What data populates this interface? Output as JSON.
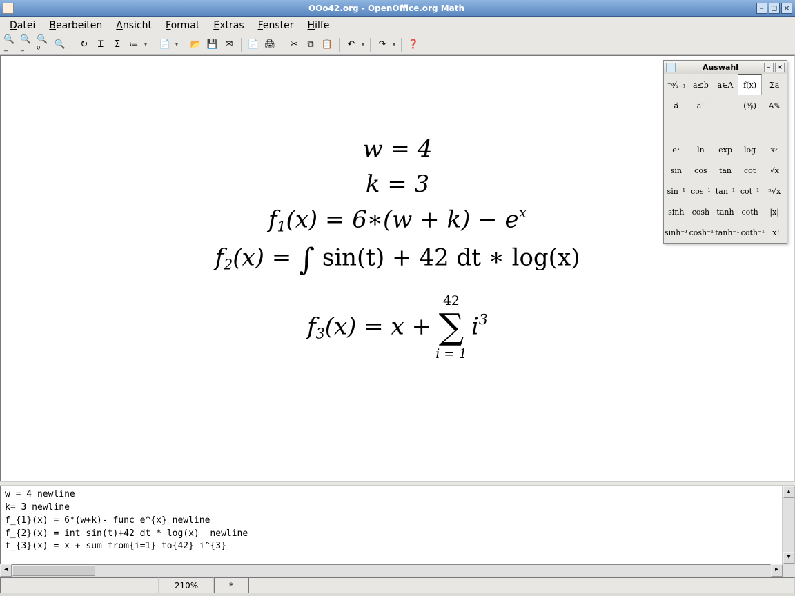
{
  "window": {
    "title": "OOo42.org - OpenOffice.org Math"
  },
  "menubar": {
    "items": [
      {
        "hot": "D",
        "rest": "atei"
      },
      {
        "hot": "B",
        "rest": "earbeiten"
      },
      {
        "hot": "A",
        "rest": "nsicht"
      },
      {
        "hot": "F",
        "rest": "ormat"
      },
      {
        "hot": "E",
        "rest": "xtras"
      },
      {
        "hot": "F",
        "rest": "enster"
      },
      {
        "hot": "H",
        "rest": "ilfe"
      }
    ]
  },
  "toolbar": {
    "groups": [
      [
        "zoom-in-icon",
        "zoom-out-icon",
        "zoom-100-icon",
        "zoom-page-icon"
      ],
      [
        "refresh-icon",
        "cursor-icon",
        "sigma-icon",
        "catalog-icon"
      ],
      [
        "new-doc-icon"
      ],
      [
        "open-icon",
        "save-icon",
        "mail-icon"
      ],
      [
        "export-pdf-icon",
        "print-icon"
      ],
      [
        "cut-icon",
        "copy-icon",
        "paste-icon"
      ],
      [
        "undo-icon"
      ],
      [
        "redo-icon"
      ],
      [
        "help-icon"
      ]
    ],
    "glyphs": {
      "zoom-in-icon": "🔍₊",
      "zoom-out-icon": "🔍₋",
      "zoom-100-icon": "🔍⁰",
      "zoom-page-icon": "🔍",
      "refresh-icon": "↻",
      "cursor-icon": "Ꮖ",
      "sigma-icon": "Σ",
      "catalog-icon": "≔",
      "new-doc-icon": "📄",
      "open-icon": "📂",
      "save-icon": "💾",
      "mail-icon": "✉",
      "export-pdf-icon": "📄",
      "print-icon": "🖨",
      "cut-icon": "✂",
      "copy-icon": "⧉",
      "paste-icon": "📋",
      "undo-icon": "↶",
      "redo-icon": "↷",
      "help-icon": "❓"
    }
  },
  "formulas": {
    "line1": "w = 4",
    "line2": "k = 3",
    "line3_lhs": "f",
    "line3_sub": "1",
    "line3_mid": "(x) = 6∗(w + k) − e",
    "line3_sup": "x",
    "line4_lhs": "f",
    "line4_sub": "2",
    "line4_mid1": "(x) = ",
    "line4_int": "∫",
    "line4_mid2": " sin(t) + 42 dt ∗ log(x)",
    "line5_lhs": "f",
    "line5_sub": "3",
    "line5_mid1": "(x) = x + ",
    "line5_sum": "∑",
    "line5_top": "42",
    "line5_bot": "i = 1",
    "line5_mid2": " i",
    "line5_sup": "3"
  },
  "editor": {
    "text": "w = 4 newline\nk= 3 newline\nf_{1}(x) = 6*(w+k)- func e^{x} newline\nf_{2}(x) = int sin(t)+42 dt * log(x)  newline\nf_{3}(x) = x + sum from{i=1} to{42} i^{3}"
  },
  "statusbar": {
    "zoom": "210%",
    "modified": "*"
  },
  "palette": {
    "title": "Auswahl",
    "row1": [
      "⁺ᵃ⁄ₐ₋ᵦ",
      "a≤b",
      "a∈A",
      "f(x)",
      "Σa"
    ],
    "row2": [
      "a⃗",
      "aᵀ",
      "",
      "(ᵃ⁄ᵦ)",
      "A̲✎"
    ],
    "fns": [
      [
        "eˣ",
        "ln",
        "exp",
        "log",
        "xʸ"
      ],
      [
        "sin",
        "cos",
        "tan",
        "cot",
        "√x"
      ],
      [
        "sin⁻¹",
        "cos⁻¹",
        "tan⁻¹",
        "cot⁻¹",
        "ⁿ√x"
      ],
      [
        "sinh",
        "cosh",
        "tanh",
        "coth",
        "|x|"
      ],
      [
        "sinh⁻¹",
        "cosh⁻¹",
        "tanh⁻¹",
        "coth⁻¹",
        "x!"
      ]
    ]
  }
}
